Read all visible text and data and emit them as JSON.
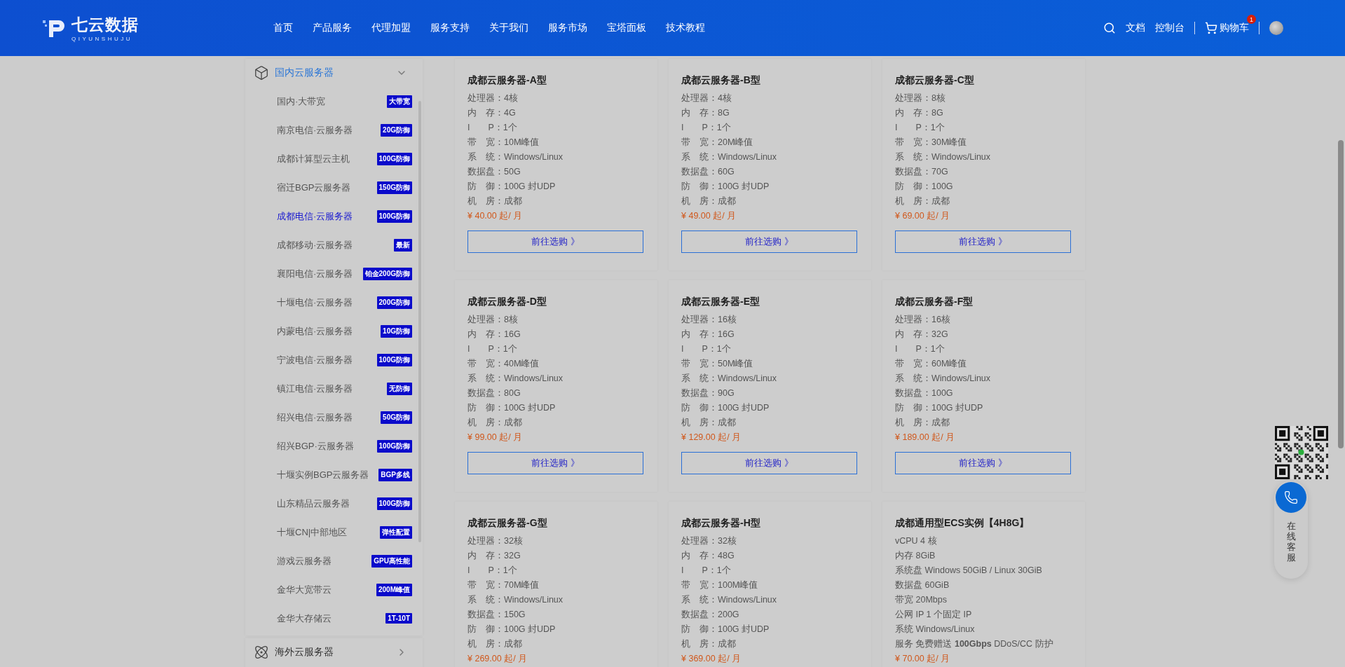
{
  "header": {
    "logo": {
      "name": "七云数据",
      "subtitle": "QIYUNSHUJU"
    },
    "nav": [
      "首页",
      "产品服务",
      "代理加盟",
      "服务支持",
      "关于我们",
      "服务市场",
      "宝塔面板",
      "技术教程"
    ],
    "links": [
      "文档",
      "控制台"
    ],
    "cart": {
      "label": "购物车",
      "count": "1"
    }
  },
  "sidebar": {
    "categories": [
      {
        "title": "国内云服务器",
        "expanded": true,
        "items": [
          {
            "label": "国内·大带宽",
            "tag": "大带宽",
            "selected": false
          },
          {
            "label": "南京电信·云服务器",
            "tag": "20G防御",
            "selected": false
          },
          {
            "label": "成都计算型云主机",
            "tag": "100G防御",
            "selected": false
          },
          {
            "label": "宿迁BGP云服务器",
            "tag": "150G防御",
            "selected": false
          },
          {
            "label": "成都电信·云服务器",
            "tag": "100G防御",
            "selected": true
          },
          {
            "label": "成都移动·云服务器",
            "tag": "最新",
            "selected": false
          },
          {
            "label": "襄阳电信·云服务器",
            "tag": "铂金200G防御",
            "selected": false
          },
          {
            "label": "十堰电信·云服务器",
            "tag": "200G防御",
            "selected": false
          },
          {
            "label": "内蒙电信·云服务器",
            "tag": "10G防御",
            "selected": false
          },
          {
            "label": "宁波电信·云服务器",
            "tag": "100G防御",
            "selected": false
          },
          {
            "label": "镇江电信·云服务器",
            "tag": "无防御",
            "selected": false
          },
          {
            "label": "绍兴电信·云服务器",
            "tag": "50G防御",
            "selected": false
          },
          {
            "label": "绍兴BGP·云服务器",
            "tag": "100G防御",
            "selected": false
          },
          {
            "label": "十堰实例BGP云服务器",
            "tag": "BGP多线",
            "selected": false
          },
          {
            "label": "山东精品云服务器",
            "tag": "100G防御",
            "selected": false
          },
          {
            "label": "十堰CN|中部地区",
            "tag": "弹性配置",
            "selected": false
          },
          {
            "label": "游戏云服务器",
            "tag": "GPU高性能",
            "selected": false
          },
          {
            "label": "金华大宽带云",
            "tag": "200M峰值",
            "selected": false
          },
          {
            "label": "金华大存储云",
            "tag": "1T-10T",
            "selected": false
          }
        ]
      },
      {
        "title": "海外云服务器",
        "expanded": false
      }
    ]
  },
  "products": [
    {
      "title": "成都云服务器-A型",
      "lines": [
        "处理器：4核",
        "内　存：4G",
        "I　　P：1个",
        "带　宽：10M峰值",
        "系　统：Windows/Linux",
        "数据盘：50G",
        "防　御：100G 封UDP",
        "机　房：成都"
      ],
      "price": "¥ 40.00 起/ 月",
      "button": "前往选购 》"
    },
    {
      "title": "成都云服务器-B型",
      "lines": [
        "处理器：4核",
        "内　存：8G",
        "I　　P：1个",
        "带　宽：20M峰值",
        "系　统：Windows/Linux",
        "数据盘：60G",
        "防　御：100G 封UDP",
        "机　房：成都"
      ],
      "price": "¥ 49.00 起/ 月",
      "button": "前往选购 》"
    },
    {
      "title": "成都云服务器-C型",
      "lines": [
        "处理器：8核",
        "内　存：8G",
        "I　　P：1个",
        "带　宽：30M峰值",
        "系　统：Windows/Linux",
        "数据盘：70G",
        "防　御：100G",
        "机　房：成都"
      ],
      "price": "¥ 69.00 起/ 月",
      "button": "前往选购 》"
    },
    {
      "title": "成都云服务器-D型",
      "lines": [
        "处理器：8核",
        "内　存：16G",
        "I　　P：1个",
        "带　宽：40M峰值",
        "系　统：Windows/Linux",
        "数据盘：80G",
        "防　御：100G 封UDP",
        "机　房：成都"
      ],
      "price": "¥ 99.00 起/ 月",
      "button": "前往选购 》"
    },
    {
      "title": "成都云服务器-E型",
      "lines": [
        "处理器：16核",
        "内　存：16G",
        "I　　P：1个",
        "带　宽：50M峰值",
        "系　统：Windows/Linux",
        "数据盘：90G",
        "防　御：100G 封UDP",
        "机　房：成都"
      ],
      "price": "¥ 129.00 起/ 月",
      "button": "前往选购 》"
    },
    {
      "title": "成都云服务器-F型",
      "lines": [
        "处理器：16核",
        "内　存：32G",
        "I　　P：1个",
        "带　宽：60M峰值",
        "系　统：Windows/Linux",
        "数据盘：100G",
        "防　御：100G 封UDP",
        "机　房：成都"
      ],
      "price": "¥ 189.00 起/ 月",
      "button": "前往选购 》"
    },
    {
      "title": "成都云服务器-G型",
      "lines": [
        "处理器：32核",
        "内　存：32G",
        "I　　P：1个",
        "带　宽：70M峰值",
        "系　统：Windows/Linux",
        "数据盘：150G",
        "防　御：100G 封UDP",
        "机　房：成都"
      ],
      "price": "¥ 269.00 起/ 月"
    },
    {
      "title": "成都云服务器-H型",
      "lines": [
        "处理器：32核",
        "内　存：48G",
        "I　　P：1个",
        "带　宽：100M峰值",
        "系　统：Windows/Linux",
        "数据盘：200G",
        "防　御：100G 封UDP",
        "机　房：成都"
      ],
      "price": "¥ 369.00 起/ 月"
    },
    {
      "title": "成都通用型ECS实例【4H8G】",
      "lines": [
        "vCPU 4 核",
        "内存 8GiB",
        "系统盘 Windows 50GiB / Linux 30GiB",
        "数据盘 60GiB",
        "带宽 20Mbps",
        "公网 IP 1 个固定 IP",
        "系统 Windows/Linux",
        "服务 免费赠送 **100Gbps** DDoS/CC 防护"
      ],
      "price": "¥ 70.00 起/ 月"
    }
  ],
  "support": {
    "label": "在线客服"
  }
}
